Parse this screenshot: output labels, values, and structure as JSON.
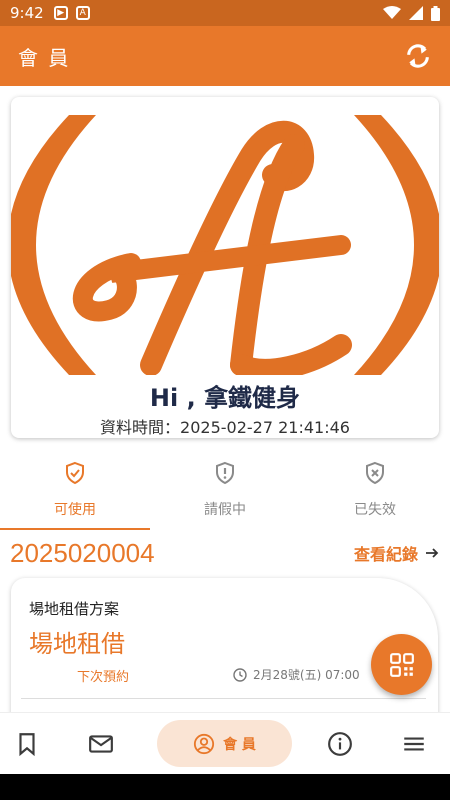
{
  "status_bar": {
    "time": "9:42",
    "icons": [
      "play-icon",
      "a-icon",
      "wifi-icon",
      "signal-icon",
      "battery-icon"
    ]
  },
  "app_bar": {
    "title": "會 員",
    "refresh_icon": "refresh-icon"
  },
  "profile_card": {
    "greeting": "Hi , 拿鐵健身",
    "timestamp": "資料時間：2025-02-27 21:41:46"
  },
  "tabs": [
    {
      "label": "可使用",
      "icon": "shield-check-icon",
      "active": true
    },
    {
      "label": "請假中",
      "icon": "shield-alert-icon",
      "active": false
    },
    {
      "label": "已失效",
      "icon": "shield-x-icon",
      "active": false
    }
  ],
  "member": {
    "id": "2025020004",
    "view_records": "查看紀錄"
  },
  "plan": {
    "label": "場地租借方案",
    "name": "場地租借",
    "next_label": "下次預約",
    "next_time": "2月28號(五) 07:00"
  },
  "bottom_nav": {
    "active_label": "會 員",
    "items": [
      "bookmark-icon",
      "mail-icon",
      "account-icon",
      "info-icon",
      "menu-icon"
    ]
  },
  "colors": {
    "primary": "#e8782a",
    "status_bar": "#c9661f",
    "pill": "#fae4d4",
    "title_text": "#1f2a48"
  }
}
